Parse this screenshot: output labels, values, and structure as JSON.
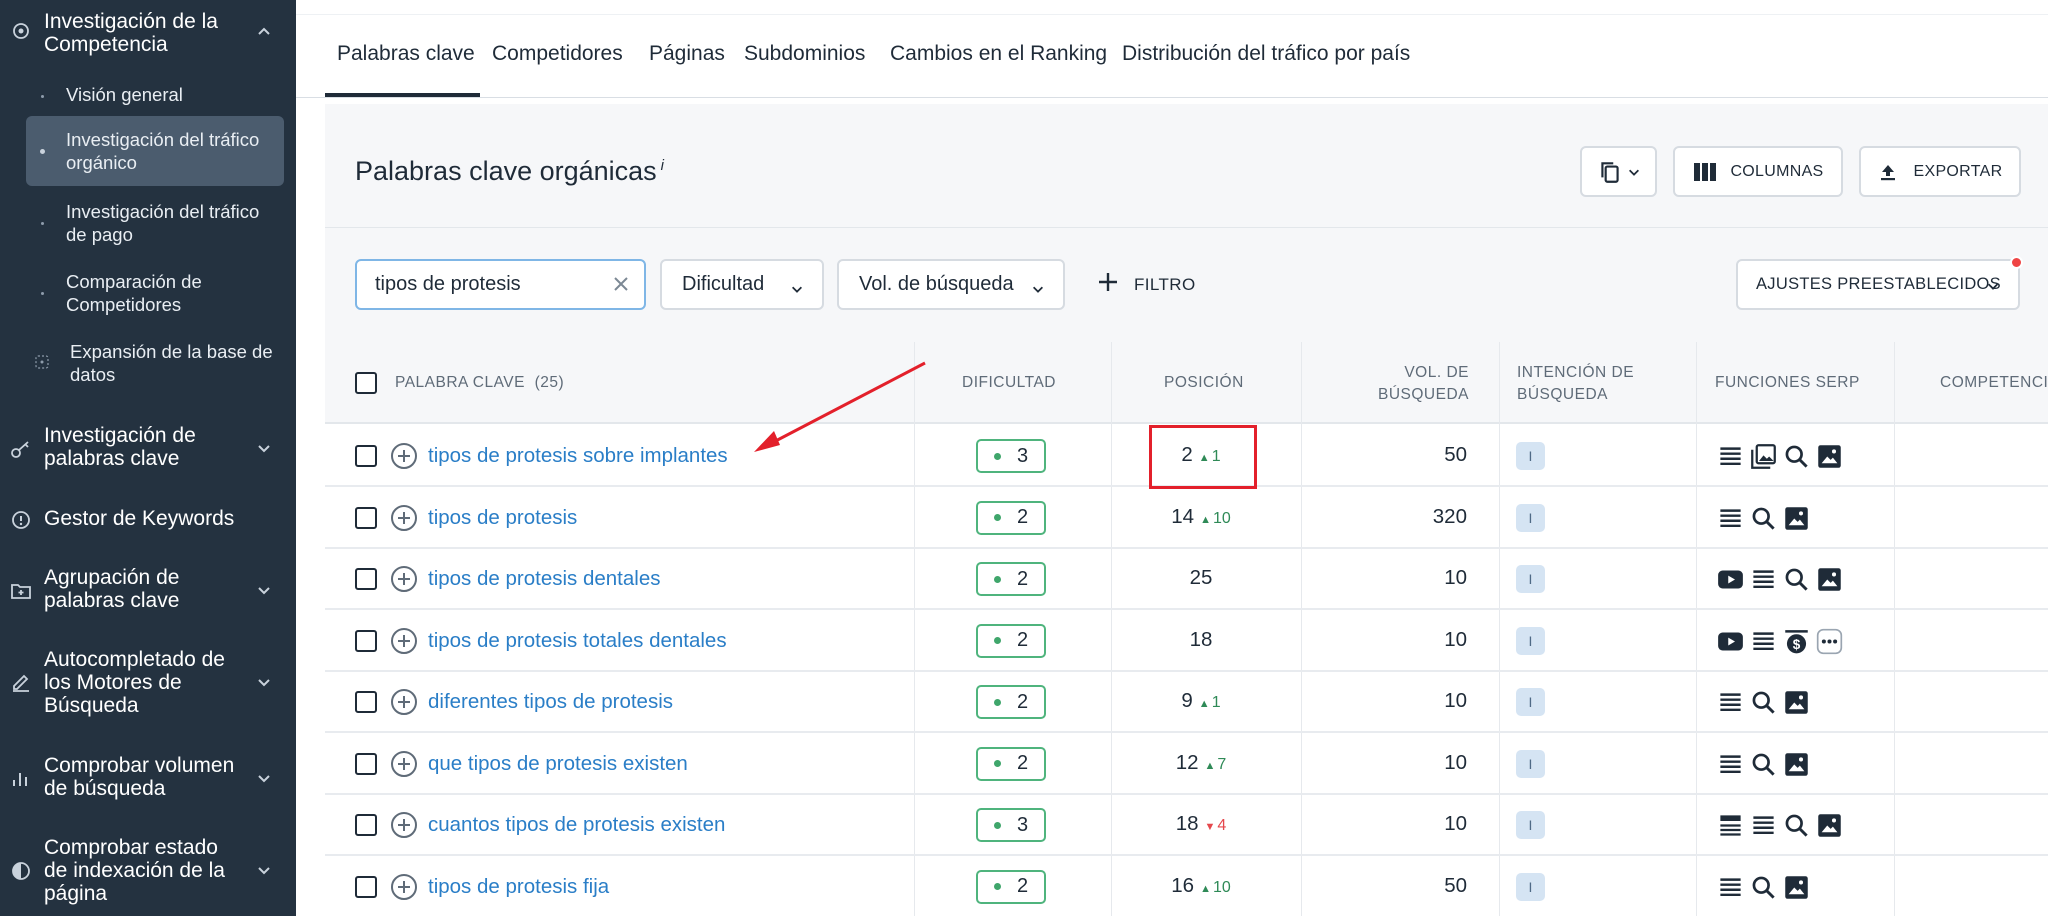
{
  "sidebar": {
    "competitor_section": {
      "label": "Investigación de la Competencia",
      "icon": "eye-target-icon"
    },
    "sub_items": [
      {
        "label": "Visión general",
        "active": false
      },
      {
        "label": "Investigación del tráfico orgánico",
        "active": true
      },
      {
        "label": "Investigación del tráfico de pago",
        "active": false
      },
      {
        "label": "Comparación de Competidores",
        "active": false
      },
      {
        "label": "Expansión de la base de datos",
        "active": false
      }
    ],
    "sections": [
      {
        "label": "Investigación de palabras clave",
        "icon": "key-icon"
      },
      {
        "label": "Gestor de Keywords",
        "icon": "info-circle-icon"
      },
      {
        "label": "Agrupación de palabras clave",
        "icon": "folder-plus-icon"
      },
      {
        "label": "Autocompletado de los Motores de Búsqueda",
        "icon": "pencil-icon"
      },
      {
        "label": "Comprobar volumen de búsqueda",
        "icon": "bar-chart-icon"
      },
      {
        "label": "Comprobar estado de indexación de la página",
        "icon": "half-circle-icon"
      }
    ]
  },
  "tabs": [
    {
      "label": "Palabras clave",
      "active": true
    },
    {
      "label": "Competidores"
    },
    {
      "label": "Páginas"
    },
    {
      "label": "Subdominios"
    },
    {
      "label": "Cambios en el Ranking"
    },
    {
      "label": "Distribución del tráfico por país"
    }
  ],
  "panel": {
    "title": "Palabras clave orgánicas",
    "title_info": "i",
    "columns_button": "COLUMNAS",
    "export_button": "EXPORTAR"
  },
  "filters": {
    "search_value": "tipos de protesis",
    "difficulty_label": "Dificultad",
    "volume_label": "Vol. de búsqueda",
    "filter_label": "FILTRO",
    "presets_label": "AJUSTES PREESTABLECIDOS"
  },
  "table": {
    "headers": {
      "keyword": "PALABRA CLAVE",
      "keyword_count": "(25)",
      "difficulty": "DIFICULTAD",
      "position": "POSICIÓN",
      "volume_line1": "VOL. DE",
      "volume_line2": "BÚSQUEDA",
      "intent_line1": "INTENCIÓN DE",
      "intent_line2": "BÚSQUEDA",
      "serp": "FUNCIONES SERP",
      "competition": "COMPETENCIA"
    },
    "rows": [
      {
        "keyword": "tipos de protesis sobre implantes",
        "difficulty": "3",
        "position": "2",
        "change": "1",
        "dir": "up",
        "volume": "50",
        "intent": "I",
        "serp": [
          "list-icon",
          "images-icon",
          "search-icon",
          "image-icon"
        ]
      },
      {
        "keyword": "tipos de protesis",
        "difficulty": "2",
        "position": "14",
        "change": "10",
        "dir": "up",
        "volume": "320",
        "intent": "I",
        "serp": [
          "list-icon",
          "search-icon",
          "image-icon"
        ]
      },
      {
        "keyword": "tipos de protesis dentales",
        "difficulty": "2",
        "position": "25",
        "change": "",
        "dir": "",
        "volume": "10",
        "intent": "I",
        "serp": [
          "video-icon",
          "list-icon",
          "search-icon",
          "image-icon"
        ]
      },
      {
        "keyword": "tipos de protesis totales dentales",
        "difficulty": "2",
        "position": "18",
        "change": "",
        "dir": "",
        "volume": "10",
        "intent": "I",
        "serp": [
          "video-icon",
          "list-icon",
          "paid-icon",
          "more-icon"
        ]
      },
      {
        "keyword": "diferentes tipos de protesis",
        "difficulty": "2",
        "position": "9",
        "change": "1",
        "dir": "up",
        "volume": "10",
        "intent": "I",
        "serp": [
          "list-icon",
          "search-icon",
          "image-icon"
        ]
      },
      {
        "keyword": "que tipos de protesis existen",
        "difficulty": "2",
        "position": "12",
        "change": "7",
        "dir": "up",
        "volume": "10",
        "intent": "I",
        "serp": [
          "list-icon",
          "search-icon",
          "image-icon"
        ]
      },
      {
        "keyword": "cuantos tipos de protesis existen",
        "difficulty": "3",
        "position": "18",
        "change": "4",
        "dir": "down",
        "volume": "10",
        "intent": "I",
        "serp": [
          "featured-list-icon",
          "list-icon",
          "search-icon",
          "image-icon"
        ]
      },
      {
        "keyword": "tipos de protesis fija",
        "difficulty": "2",
        "position": "16",
        "change": "10",
        "dir": "up",
        "volume": "50",
        "intent": "I",
        "serp": [
          "list-icon",
          "search-icon",
          "image-icon"
        ]
      }
    ]
  },
  "annotation": {
    "highlight_color": "#e3202b"
  },
  "colors": {
    "sidebar_bg": "#243240",
    "link": "#2a7ec7",
    "accent_green": "#3fa66b",
    "accent_red": "#e5484d"
  }
}
